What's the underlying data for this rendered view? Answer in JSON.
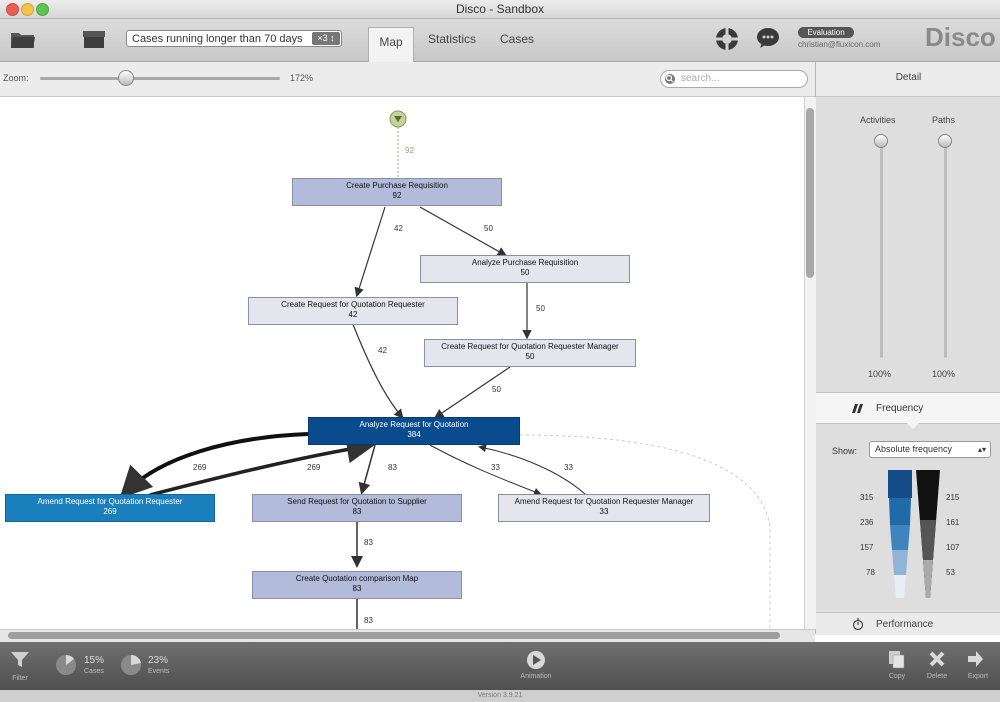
{
  "window": {
    "title": "Disco - Sandbox"
  },
  "toolbar": {
    "filter_value": "Cases running longer than 70 days",
    "filter_badge": "×3 ↕",
    "tabs": [
      {
        "label": "Map"
      },
      {
        "label": "Statistics"
      },
      {
        "label": "Cases"
      }
    ],
    "account_badge": "Evaluation",
    "account_email": "christian@fluxicon.com",
    "brand": "Disco"
  },
  "zoom": {
    "label": "Zoom:",
    "value_label": "172%",
    "level_percent": 172
  },
  "search": {
    "placeholder": "search..."
  },
  "detail": {
    "title": "Detail",
    "activities_label": "Activities",
    "paths_label": "Paths",
    "activities_value": "100%",
    "paths_value": "100%"
  },
  "frequency": {
    "title": "Frequency",
    "show_label": "Show:",
    "show_value": "Absolute frequency",
    "left_scale": [
      "315",
      "236",
      "157",
      "78"
    ],
    "right_scale": [
      "215",
      "161",
      "107",
      "53"
    ]
  },
  "performance": {
    "title": "Performance"
  },
  "map": {
    "start_count": "92",
    "nodes": [
      {
        "label": "Create Purchase Requisition",
        "count": "92"
      },
      {
        "label": "Analyze Purchase Requisition",
        "count": "50"
      },
      {
        "label": "Create Request for Quotation Requester",
        "count": "42"
      },
      {
        "label": "Create Request for Quotation Requester Manager",
        "count": "50"
      },
      {
        "label": "Analyze Request for Quotation",
        "count": "384"
      },
      {
        "label": "Amend Request for Quotation Requester",
        "count": "269"
      },
      {
        "label": "Send Request for Quotation to Supplier",
        "count": "83"
      },
      {
        "label": "Amend Request for Quotation Requester Manager",
        "count": "33"
      },
      {
        "label": "Create Quotation comparison Map",
        "count": "83"
      }
    ],
    "edges": [
      "42",
      "50",
      "50",
      "42",
      "50",
      "269",
      "269",
      "83",
      "33",
      "33",
      "83",
      "83"
    ]
  },
  "bottom": {
    "filter_label": "Filter",
    "cases_pct": "15%",
    "cases_label": "Cases",
    "events_pct": "23%",
    "events_label": "Events",
    "animation_label": "Animation",
    "copy_label": "Copy",
    "delete_label": "Delete",
    "export_label": "Export"
  },
  "status": {
    "version": "Version 3.9.21"
  }
}
